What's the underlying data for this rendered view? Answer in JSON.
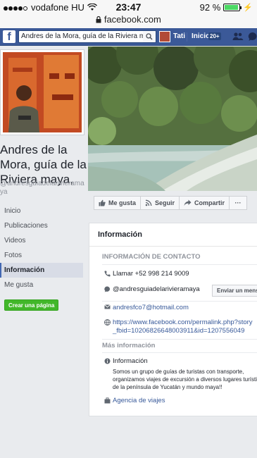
{
  "status_bar": {
    "carrier": "vodafone HU",
    "time": "23:47",
    "url": "facebook.com",
    "battery": "92 %",
    "battery_level": 0.92
  },
  "fb_header": {
    "logo": "f",
    "search_value": "Andres de la Mora, guía de la Riviera m",
    "user_name": "Tati",
    "home_label": "Inicio",
    "home_badge": "20+"
  },
  "page": {
    "title": "Andres de la Mora, guía de la Riviera maya,",
    "handle": "@andresguiadelarivieramaya"
  },
  "nav": {
    "items": [
      "Inicio",
      "Publicaciones",
      "Videos",
      "Fotos",
      "Información",
      "Me gusta"
    ],
    "active": "Información",
    "create_page": "Crear una página"
  },
  "actions": {
    "like": "Me gusta",
    "follow": "Seguir",
    "share": "Compartir",
    "more": "···"
  },
  "info": {
    "title": "Información",
    "contact_header": "INFORMACIÓN DE CONTACTO",
    "phone": "Llamar +52 998 214 9009",
    "messenger": "@andresguiadelarivieramaya",
    "send_message": "Enviar un mensaje",
    "email": "andresfco7@hotmail.com",
    "link": "https://www.facebook.com/permalink.php?story_fbid=10206826648003911&id=1207556049",
    "more_header": "Más información",
    "about_label": "Información",
    "about_text": "Somos un grupo de guías de turistas con transporte, organizamos viajes de excursión a diversos lugares turísticos de la península de Yucatán y mundo maya!!",
    "category": "Agencia de viajes"
  }
}
